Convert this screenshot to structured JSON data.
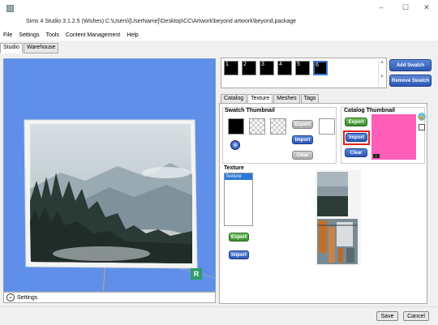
{
  "window": {
    "title": "Sims 4 Studio 3.1.2.5 (Wishes)  C:\\Users\\[UserName]\\Desktop\\CC\\Artwork\\beyond artwork\\beyond.package",
    "minimize": "–",
    "maximize": "☐",
    "close": "✕"
  },
  "menu": [
    "File",
    "Settings",
    "Tools",
    "Content Management",
    "Help"
  ],
  "top_tabs": [
    {
      "label": "Studio",
      "active": true
    },
    {
      "label": "Warehouse",
      "active": false
    }
  ],
  "preview": {
    "settings_label": "Settings",
    "badge": "R"
  },
  "swatches": {
    "items": [
      "1",
      "2",
      "3",
      "4",
      "5",
      "6"
    ],
    "selected": "6",
    "add_label": "Add Swatch",
    "remove_label": "Remove Swatch"
  },
  "inner_tabs": [
    {
      "label": "Catalog",
      "active": false
    },
    {
      "label": "Texture",
      "active": true
    },
    {
      "label": "Meshes",
      "active": false
    },
    {
      "label": "Tags",
      "active": false
    }
  ],
  "swatch_thumbnail": {
    "title": "Swatch Thumbnail",
    "export_label": "Export",
    "import_label": "Import",
    "clear_label": "Clear"
  },
  "catalog_thumbnail": {
    "title": "Catalog Thumbnail",
    "export_label": "Export",
    "import_label": "Import",
    "clear_label": "Clear",
    "preview_color": "#ff5fb8"
  },
  "texture": {
    "title": "Texture",
    "list_items": [
      "Texture"
    ],
    "export_label": "Export",
    "import_label": "Import"
  },
  "footer": {
    "save_label": "Save",
    "cancel_label": "Cancel"
  },
  "colors": {
    "accent_blue": "#2c58b4",
    "preview_bg": "#5f8fe8",
    "highlight_red": "#e02020"
  }
}
